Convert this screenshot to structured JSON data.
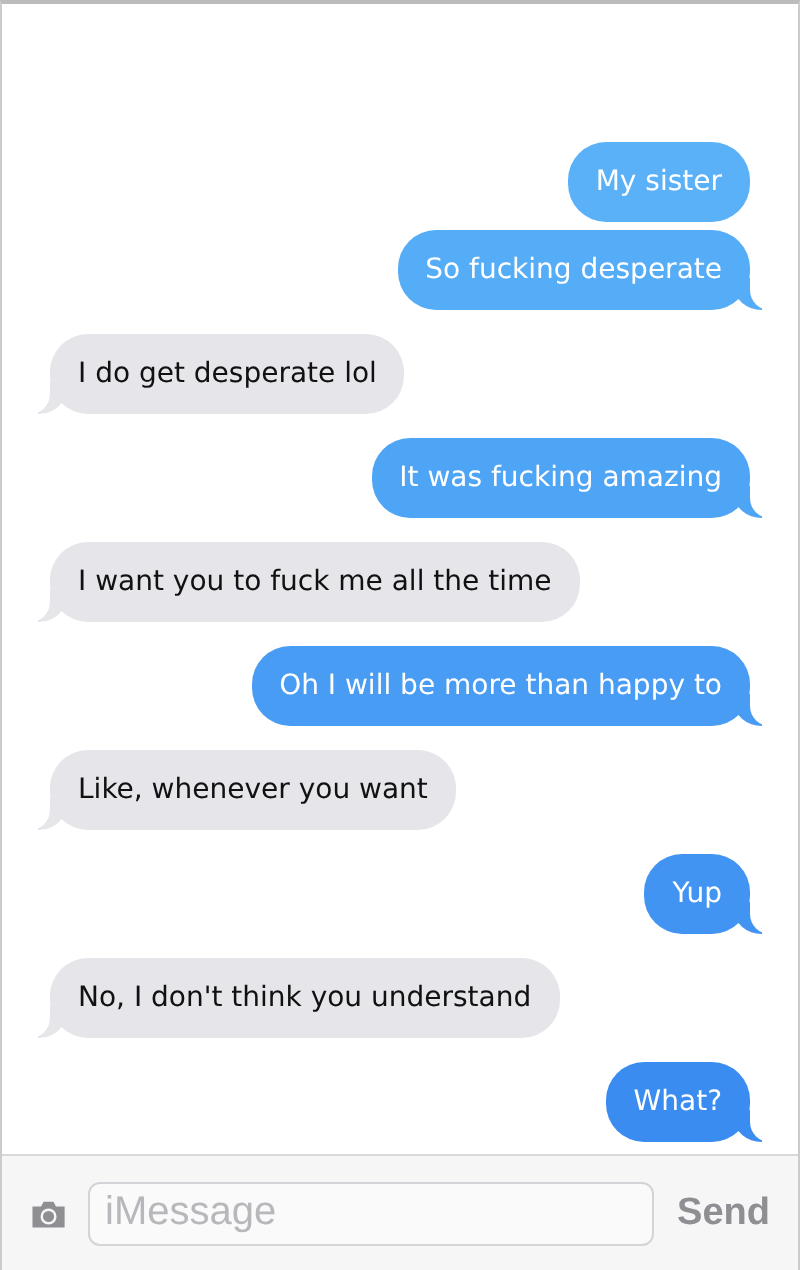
{
  "messages": [
    {
      "text": "My sister",
      "sent": true,
      "tail": false
    },
    {
      "text": "So fucking desperate",
      "sent": true,
      "tail": true
    },
    {
      "text": "I do get desperate lol",
      "sent": false,
      "tail": true
    },
    {
      "text": "It was fucking amazing",
      "sent": true,
      "tail": true
    },
    {
      "text": "I want you to fuck me all the time",
      "sent": false,
      "tail": true
    },
    {
      "text": "Oh I will be more than happy to",
      "sent": true,
      "tail": true
    },
    {
      "text": "Like, whenever you want",
      "sent": false,
      "tail": true
    },
    {
      "text": "Yup",
      "sent": true,
      "tail": true
    },
    {
      "text": "No, I don't think you understand",
      "sent": false,
      "tail": true
    },
    {
      "text": "What?",
      "sent": true,
      "tail": true
    }
  ],
  "composer": {
    "placeholder": "iMessage",
    "send_label": "Send"
  }
}
